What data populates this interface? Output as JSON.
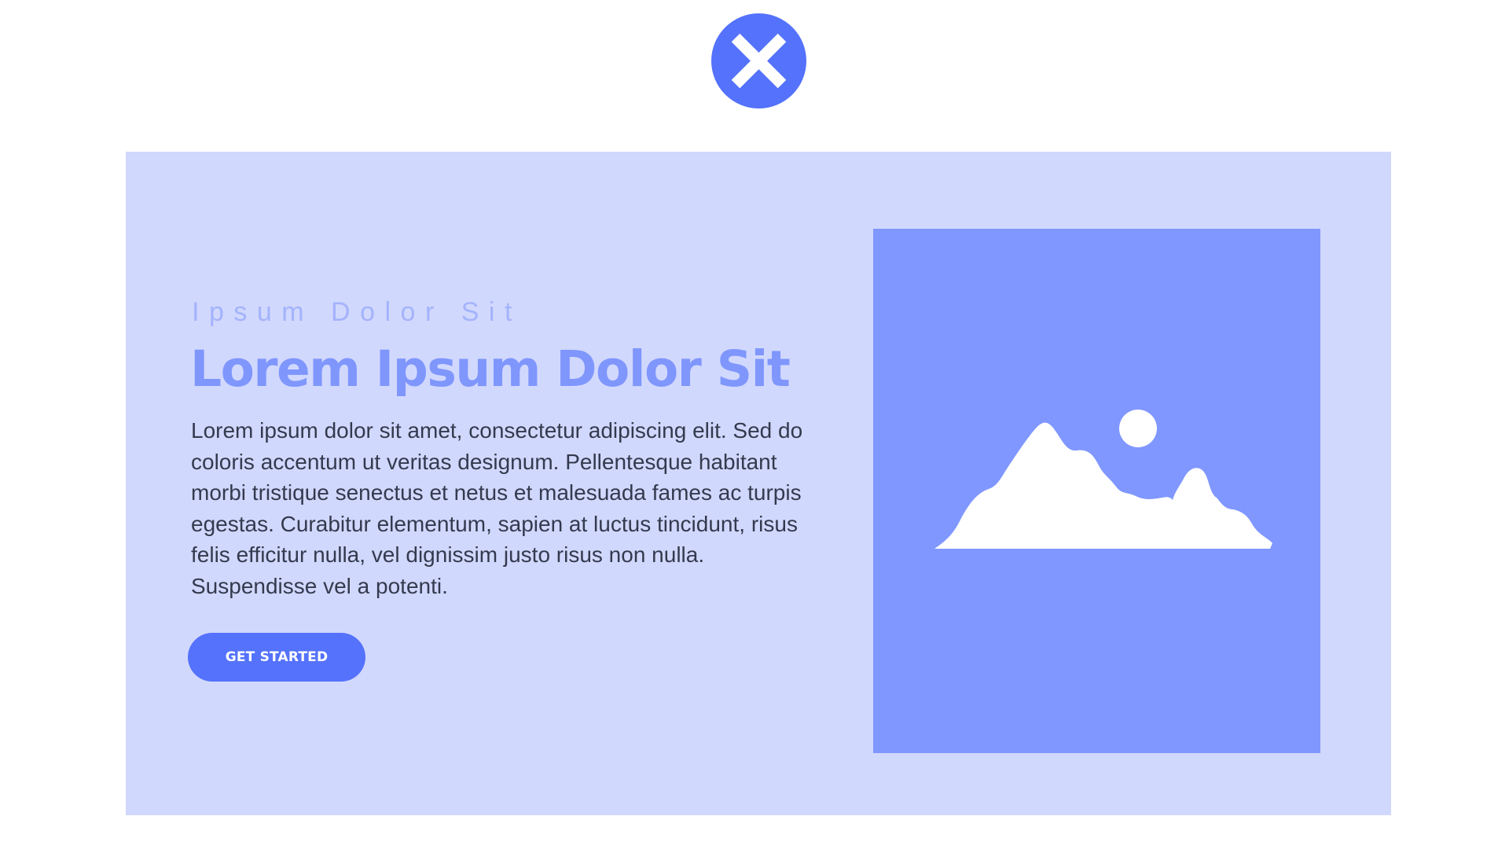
{
  "close_button": {
    "icon": "close-icon",
    "color": "#5472fb"
  },
  "hero": {
    "eyebrow": "Ipsum Dolor Sit",
    "headline": "Lorem Ipsum Dolor Sit",
    "body": "Lorem ipsum dolor sit amet, consectetur adipiscing elit. Sed do coloris accentum ut veritas designum. Pellentesque habitant morbi tristique senectus et netus et malesuada fames ac turpis egestas. Curabitur elementum, sapien at luctus tincidunt, risus felis efficitur nulla, vel dignissim justo risus non nulla. Suspendisse vel a potenti.",
    "cta_label": "GET STARTED",
    "image_icon": "image-placeholder-icon"
  },
  "colors": {
    "accent": "#5472fb",
    "panel_background": "#d1d8fd",
    "headline": "#7f96fd",
    "eyebrow": "#a4b3fc",
    "body_text": "#343a4e",
    "image_background": "#8097ff"
  }
}
